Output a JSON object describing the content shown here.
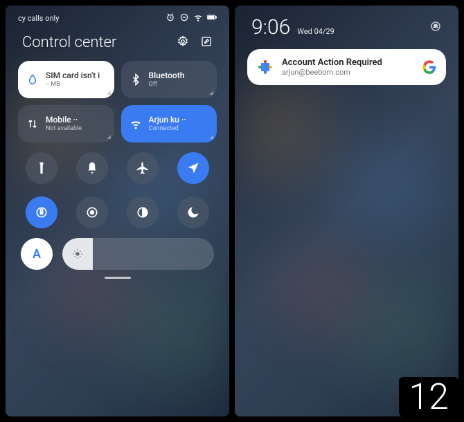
{
  "left": {
    "status": {
      "carrier": "cy calls only"
    },
    "title": "Control center",
    "tiles": {
      "sim": {
        "label": "SIM card isn't i",
        "sub": "-- MB"
      },
      "bluetooth": {
        "label": "Bluetooth",
        "sub": "Off"
      },
      "mobile": {
        "label": "Mobile ··",
        "sub": "Not available"
      },
      "wifi": {
        "label": "Arjun ku ··",
        "sub": "Connected"
      }
    },
    "auto_label": "A"
  },
  "right": {
    "time": "9:06",
    "date": "Wed 04/29",
    "notification": {
      "title": "Account Action Required",
      "subtitle": "arjun@beebom.com"
    }
  },
  "version_badge": "12"
}
